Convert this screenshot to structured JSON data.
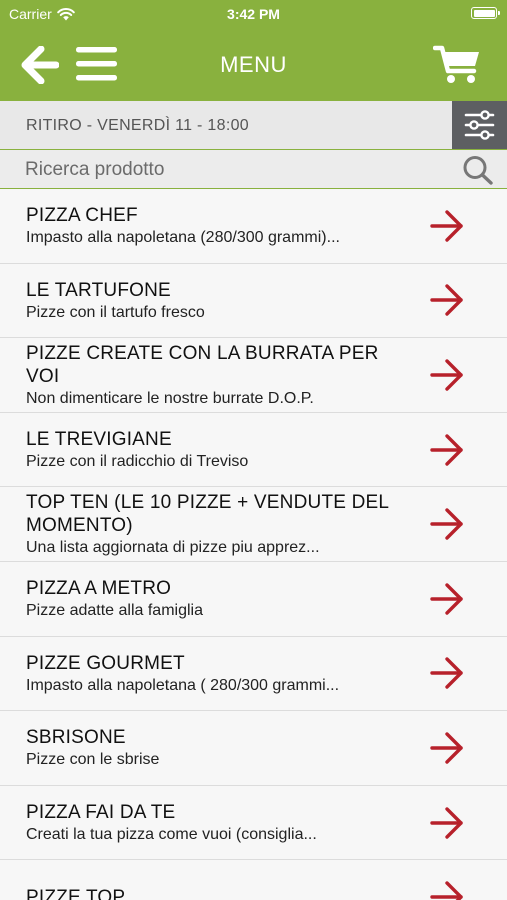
{
  "status_bar": {
    "carrier": "Carrier",
    "time": "3:42 PM"
  },
  "header": {
    "title": "MENU",
    "icons": [
      "back-arrow-icon",
      "hamburger-menu-icon",
      "shopping-cart-icon"
    ]
  },
  "pickup_bar": {
    "label": "RITIRO - VENERDÌ 11 - 18:00",
    "filter_icon": "sliders-icon"
  },
  "search": {
    "placeholder": "Ricerca prodotto",
    "value": ""
  },
  "colors": {
    "brand_green": "#89b13e",
    "arrow_red": "#b7212b",
    "filter_bg": "#5d5f62"
  },
  "categories": [
    {
      "title": "PIZZA CHEF",
      "subtitle": "Impasto alla napoletana (280/300 grammi)..."
    },
    {
      "title": "LE TARTUFONE",
      "subtitle": "Pizze con il tartufo fresco"
    },
    {
      "title": "PIZZE CREATE CON LA BURRATA PER VOI",
      "subtitle": "Non dimenticare le nostre burrate D.O.P."
    },
    {
      "title": "LE TREVIGIANE",
      "subtitle": "Pizze con il radicchio di Treviso"
    },
    {
      "title": "TOP TEN (LE 10 PIZZE + VENDUTE DEL MOMENTO)",
      "subtitle": "Una lista aggiornata di pizze piu apprez..."
    },
    {
      "title": "PIZZA A METRO",
      "subtitle": "Pizze adatte alla famiglia"
    },
    {
      "title": "PIZZE GOURMET",
      "subtitle": "Impasto alla napoletana ( 280/300 grammi..."
    },
    {
      "title": "SBRISONE",
      "subtitle": "Pizze con le sbrise"
    },
    {
      "title": "PIZZA FAI DA TE",
      "subtitle": "Creati la tua pizza come vuoi (consiglia..."
    },
    {
      "title": "PIZZE TOP",
      "subtitle": ""
    }
  ]
}
